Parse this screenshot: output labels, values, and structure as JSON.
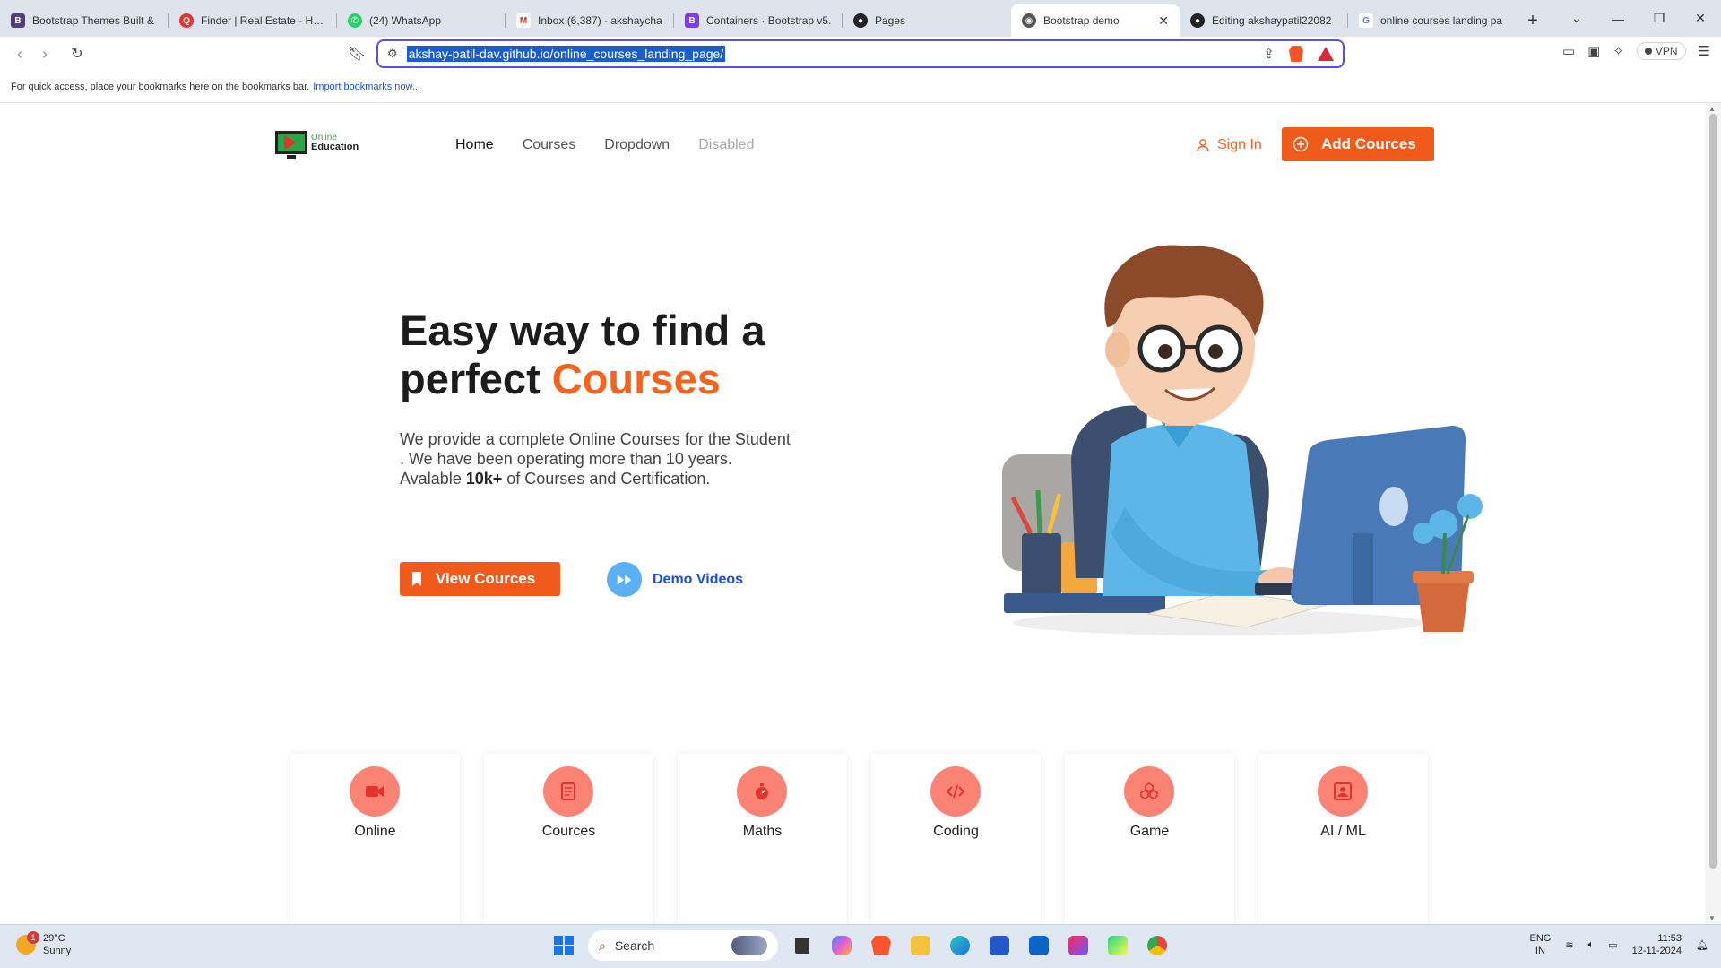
{
  "browser": {
    "tabs": [
      {
        "title": "Bootstrap Themes Built &",
        "favicon": "B",
        "color": "#563d7c"
      },
      {
        "title": "Finder | Real Estate - Hom",
        "favicon": "Q",
        "color": "#e5322d"
      },
      {
        "title": "(24) WhatsApp",
        "favicon": "W",
        "color": "#25d366"
      },
      {
        "title": "Inbox (6,387) - akshaycha",
        "favicon": "M",
        "color": "#d93025"
      },
      {
        "title": "Containers · Bootstrap v5.",
        "favicon": "B",
        "color": "#7b3fe4"
      },
      {
        "title": "Pages",
        "favicon": "G",
        "color": "#222222"
      },
      {
        "title": "Bootstrap demo",
        "favicon": "◉",
        "color": "#555555"
      },
      {
        "title": "Editing akshaypatil22082",
        "favicon": "G",
        "color": "#222222"
      },
      {
        "title": "online courses landing pa",
        "favicon": "G",
        "color": "#4285f4"
      }
    ],
    "url": "akshay-patil-dav.github.io/online_courses_landing_page/",
    "vpn_label": "VPN",
    "bookmarks_text": "For quick access, place your bookmarks here on the bookmarks bar.",
    "bookmarks_link": "Import bookmarks now..."
  },
  "site": {
    "logo": {
      "line1": "Online",
      "line2": "Education"
    },
    "nav": {
      "home": "Home",
      "courses": "Courses",
      "dropdown": "Dropdown",
      "disabled": "Disabled"
    },
    "sign_in": "Sign In",
    "add_button": "Add Cources",
    "hero": {
      "title_part1": "Easy way to find a perfect ",
      "title_highlight": "Courses",
      "desc_part1": "We provide a complete Online Courses for the Student . We have been operating more than 10 years. Avalable ",
      "desc_bold": "10k+",
      "desc_part2": " of Courses and Certification.",
      "view_button": "View Cources",
      "demo_link": "Demo Videos"
    },
    "cards": [
      {
        "label": "Online",
        "icon": "video-camera-icon"
      },
      {
        "label": "Cources",
        "icon": "book-icon"
      },
      {
        "label": "Maths",
        "icon": "stopwatch-icon"
      },
      {
        "label": "Coding",
        "icon": "code-icon"
      },
      {
        "label": "Game",
        "icon": "cubes-icon"
      },
      {
        "label": "AI / ML",
        "icon": "person-frame-icon"
      }
    ],
    "accent_color": "#f05a1a",
    "icon_bg_color": "#fb8376"
  },
  "taskbar": {
    "weather_temp": "29°C",
    "weather_desc": "Sunny",
    "weather_badge": "1",
    "search_placeholder": "Search",
    "lang_line1": "ENG",
    "lang_line2": "IN",
    "time": "11:53",
    "date": "12-11-2024"
  }
}
